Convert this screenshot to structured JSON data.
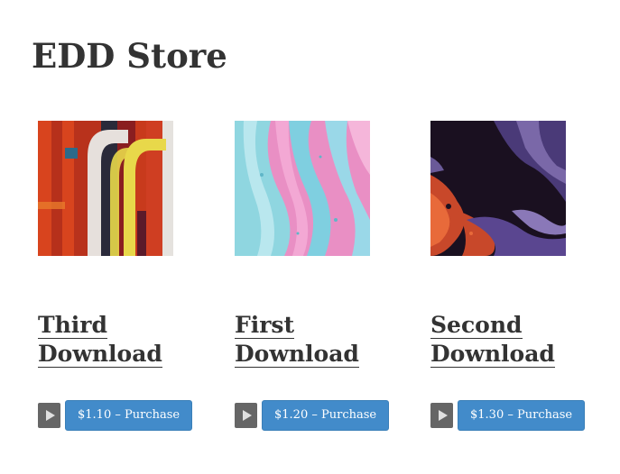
{
  "store": {
    "title": "EDD Store"
  },
  "products": [
    {
      "title": "Third Download",
      "purchase_label": "$1.10 – Purchase",
      "image": "abstract-red-yellow-painting",
      "play_icon": "play-icon"
    },
    {
      "title": "First Download",
      "purchase_label": "$1.20 – Purchase",
      "image": "pink-blue-fluid-art",
      "play_icon": "play-icon"
    },
    {
      "title": "Second Download",
      "purchase_label": "$1.30 – Purchase",
      "image": "purple-orange-fluid-art",
      "play_icon": "play-icon"
    }
  ],
  "colors": {
    "button": "#428bca",
    "play_button": "#666666",
    "text": "#333333"
  }
}
